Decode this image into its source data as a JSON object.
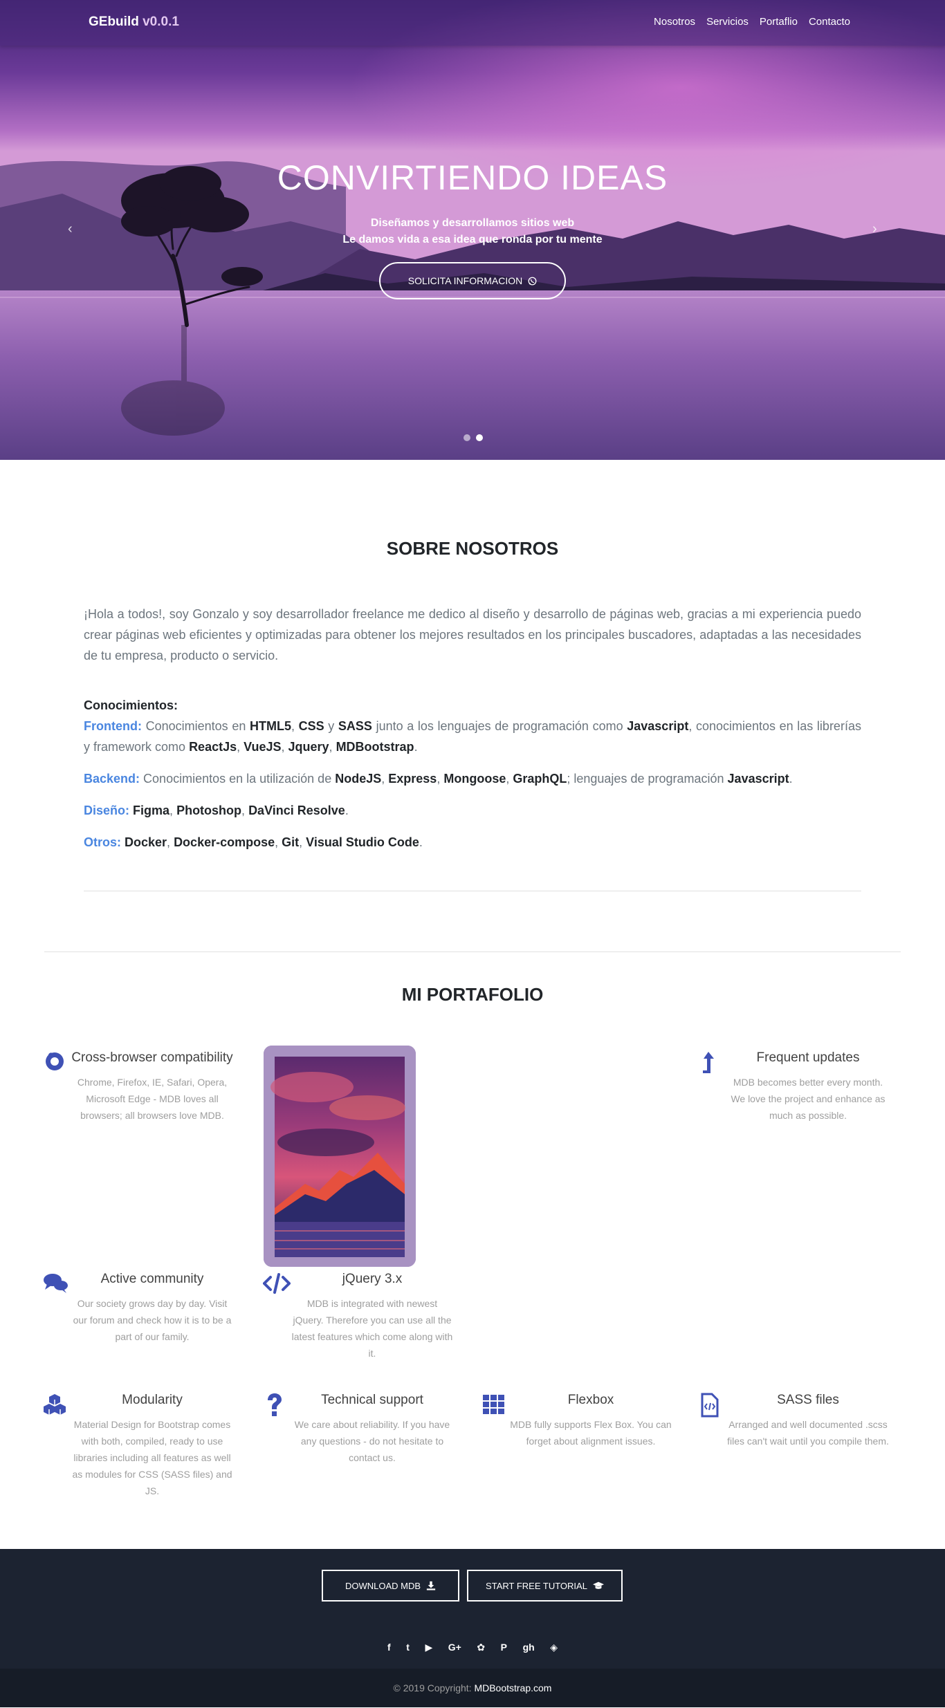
{
  "navbar": {
    "brand_name": "GEbuild",
    "brand_version": "v0.0.1",
    "links": [
      "Nosotros",
      "Servicios",
      "Portaflio",
      "Contacto"
    ]
  },
  "hero": {
    "title": "CONVIRTIENDO IDEAS",
    "subtitle_1": "Diseñamos y desarrollamos sitios web",
    "subtitle_2": "Le damos vida a esa idea que ronda por tu mente",
    "button_label": "SOLICITA INFORMACION",
    "prev_arrow": "‹",
    "next_arrow": "›",
    "active_slide": 2,
    "slide_count": 2
  },
  "about": {
    "title": "SOBRE NOSOTROS",
    "intro": "¡Hola a todos!, soy Gonzalo y soy desarrollador freelance me dedico al diseño y desarrollo de páginas web, gracias a mi experiencia puedo crear páginas web eficientes y optimizadas para obtener los mejores resultados en los principales buscadores, adaptadas a las necesidades de tu empresa, producto o servicio.",
    "skills_heading": "Conocimientos:",
    "frontend": {
      "label": "Frontend:",
      "t1": "Conocimientos en",
      "html5": "HTML5",
      "css": "CSS",
      "y": "y",
      "sass": "SASS",
      "t2": "junto a los lenguajes de programación como",
      "javascript": "Javascript",
      "t3": ", conocimientos en las librerías y framework como",
      "reactjs": "ReactJs",
      "vuejs": "VueJS",
      "jquery": "Jquery",
      "mdb": "MDBootstrap"
    },
    "backend": {
      "label": "Backend:",
      "t1": "Conocimientos en la utilización de",
      "nodejs": "NodeJS",
      "express": "Express",
      "mongoose": "Mongoose",
      "graphql": "GraphQL",
      "t2": "; lenguajes de programación",
      "javascript": "Javascript"
    },
    "design": {
      "label": "Diseño:",
      "figma": "Figma",
      "photoshop": "Photoshop",
      "davinci": "DaVinci Resolve"
    },
    "others": {
      "label": "Otros:",
      "docker": "Docker",
      "compose": "Docker-compose",
      "git": "Git",
      "vscode": "Visual Studio Code"
    }
  },
  "portfolio": {
    "title": "MI PORTAFOLIO",
    "features": [
      {
        "title": "Cross-browser compatibility",
        "desc": "Chrome, Firefox, IE, Safari, Opera, Microsoft Edge - MDB loves all browsers; all browsers love MDB.",
        "icon": "firefox-icon"
      },
      {
        "title": "Frequent updates",
        "desc": "MDB becomes better every month. We love the project and enhance as much as possible.",
        "icon": "level-up-icon"
      },
      {
        "title": "Active community",
        "desc": "Our society grows day by day. Visit our forum and check how it is to be a part of our family.",
        "icon": "comments-icon"
      },
      {
        "title": "jQuery 3.x",
        "desc": "MDB is integrated with newest jQuery. Therefore you can use all the latest features which come along with it.",
        "icon": "code-icon"
      },
      {
        "title": "Modularity",
        "desc": "Material Design for Bootstrap comes with both, compiled, ready to use libraries including all features as well as modules for CSS (SASS files) and JS.",
        "icon": "cubes-icon"
      },
      {
        "title": "Technical support",
        "desc": "We care about reliability. If you have any questions - do not hesitate to contact us.",
        "icon": "question-icon"
      },
      {
        "title": "Flexbox",
        "desc": "MDB fully supports Flex Box. You can forget about alignment issues.",
        "icon": "th-icon"
      },
      {
        "title": "SASS files",
        "desc": "Arranged and well documented .scss files can't wait until you compile them.",
        "icon": "file-code-icon"
      }
    ]
  },
  "footer": {
    "download_label": "DOWNLOAD MDB",
    "tutorial_label": "START FREE TUTORIAL",
    "social": [
      "f",
      "t",
      "▶",
      "G+",
      "✿",
      "P",
      "gh",
      "◈"
    ],
    "copyright_text": "© 2019 Copyright:",
    "copyright_link": "MDBootstrap.com"
  }
}
